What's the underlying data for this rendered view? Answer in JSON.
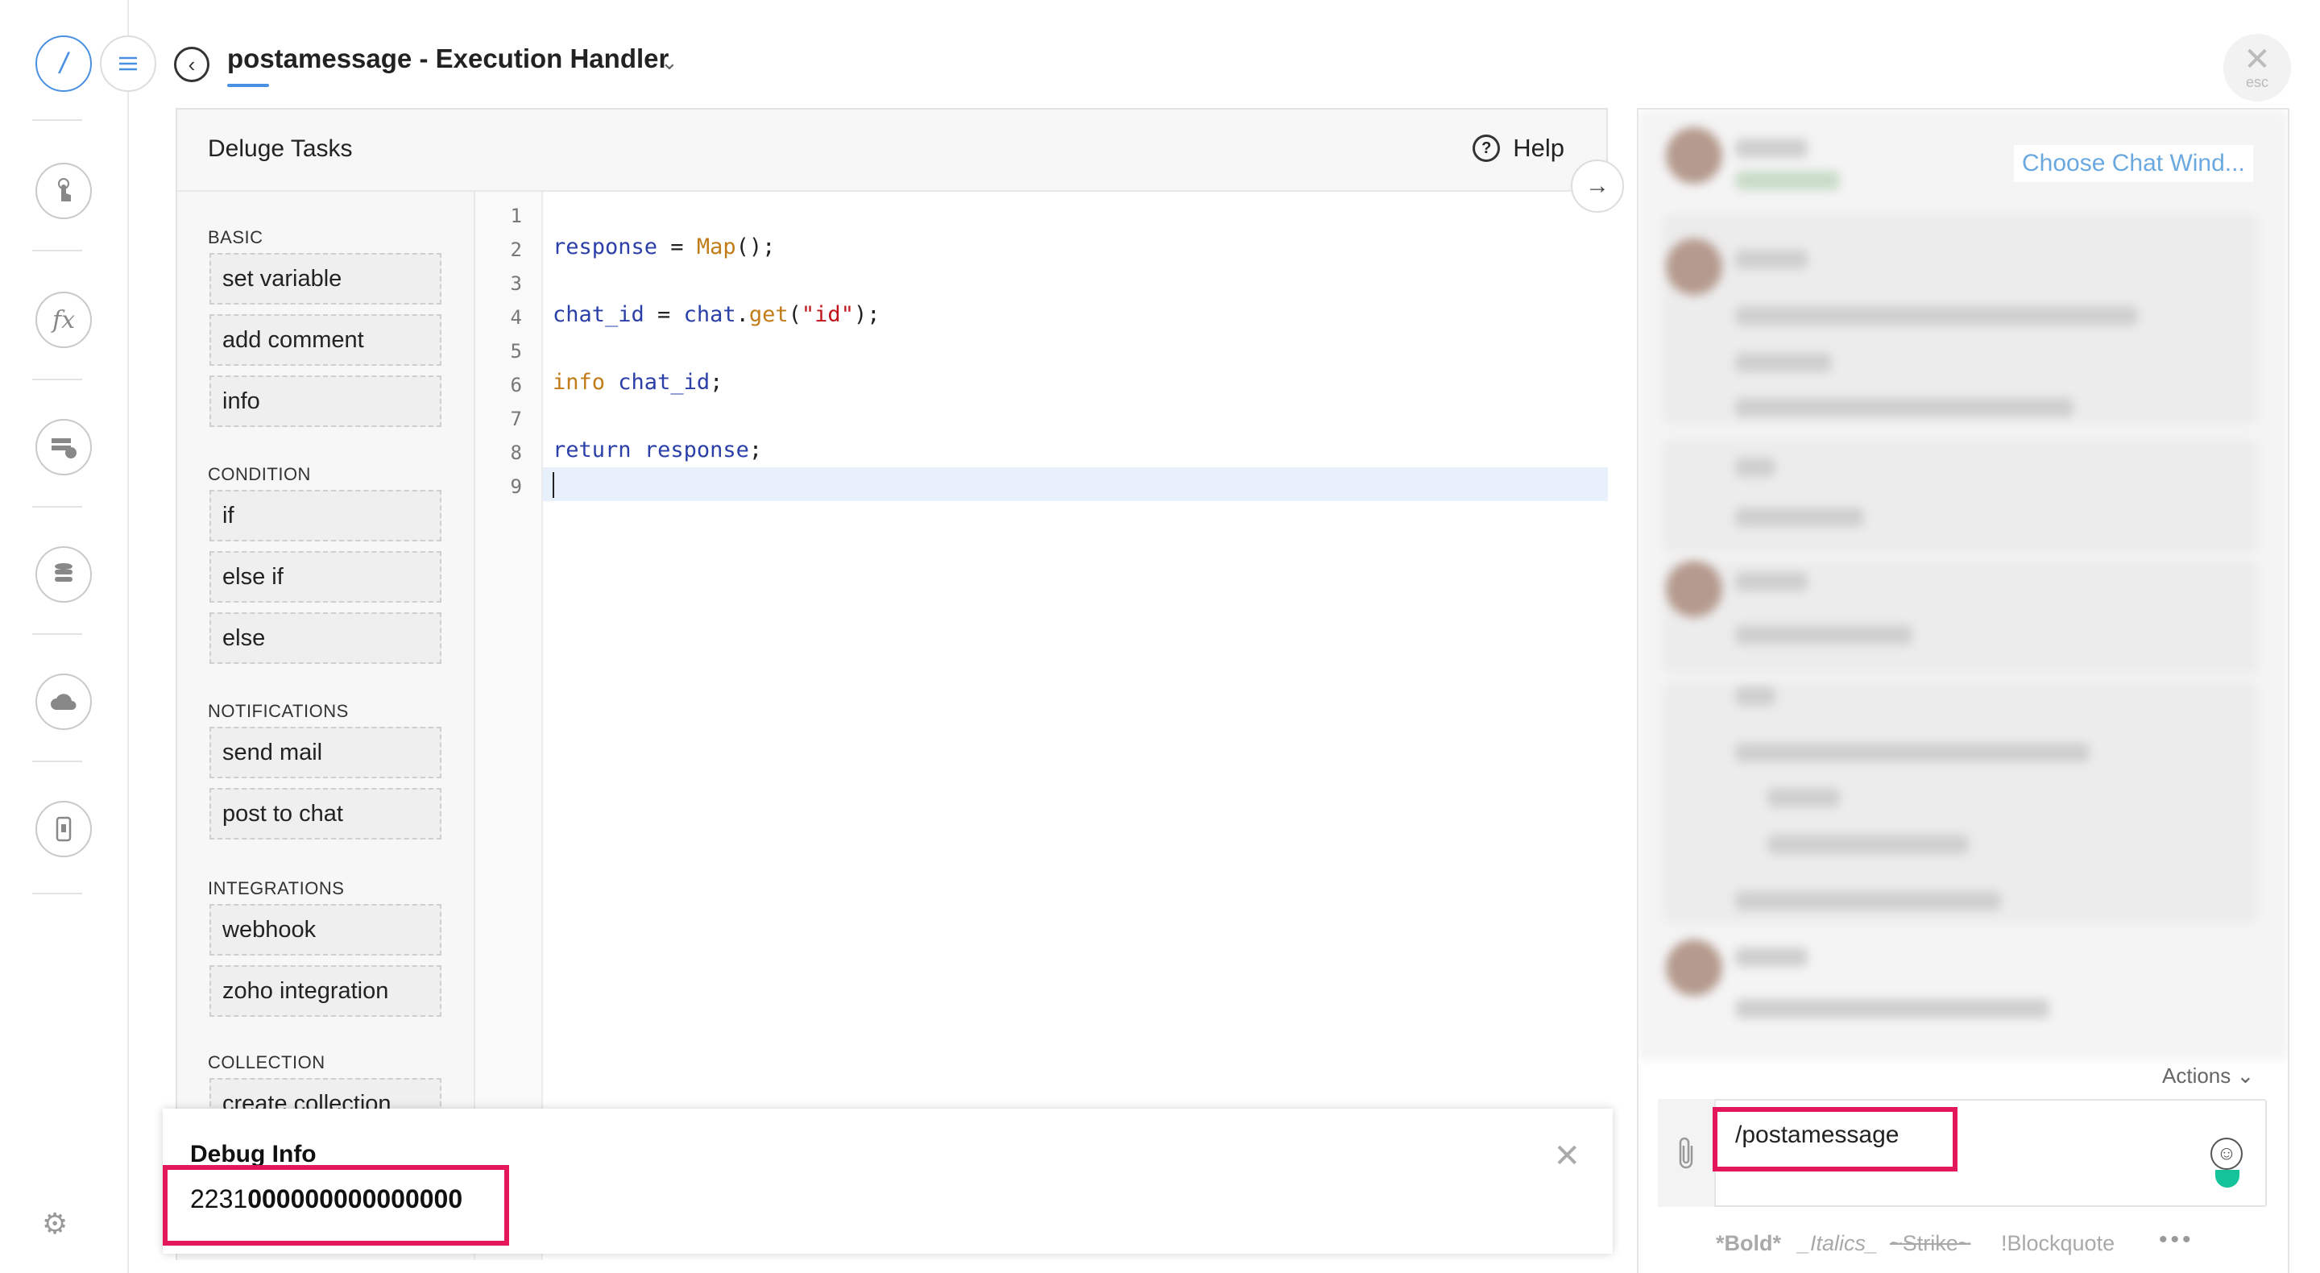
{
  "header": {
    "title": "postamessage  -  Execution Handler"
  },
  "esc": {
    "label": "esc"
  },
  "editor": {
    "panel_title": "Deluge Tasks",
    "help_label": "Help"
  },
  "tasks": {
    "categories": [
      "BASIC",
      "CONDITION",
      "NOTIFICATIONS",
      "INTEGRATIONS",
      "COLLECTION"
    ],
    "items": [
      "set variable",
      "add comment",
      "info",
      "if",
      "else if",
      "else",
      "send mail",
      "post to chat",
      "webhook",
      "zoho integration",
      "create collection"
    ]
  },
  "code": {
    "line_numbers": [
      "1",
      "2",
      "3",
      "4",
      "5",
      "6",
      "7",
      "8",
      "9"
    ],
    "lines": [
      "",
      "response = Map();",
      "",
      "chat_id = chat.get(\"id\");",
      "",
      "info chat_id;",
      "",
      "return response;",
      ""
    ]
  },
  "debug": {
    "title": "Debug Info",
    "value_prefix": "2231",
    "value_bold": "000000000000000"
  },
  "chat": {
    "choose_label": "Choose Chat Wind...",
    "actions_label": "Actions",
    "composer_value": "/postamessage",
    "format_bold": "*Bold*",
    "format_italics": "_Italics_",
    "format_strike": "~Strike~",
    "format_blockquote": "!Blockquote",
    "format_more": "•••"
  },
  "colors": {
    "accent": "#4a90e2",
    "highlight": "#e3175a",
    "link": "#6aa9e0"
  }
}
